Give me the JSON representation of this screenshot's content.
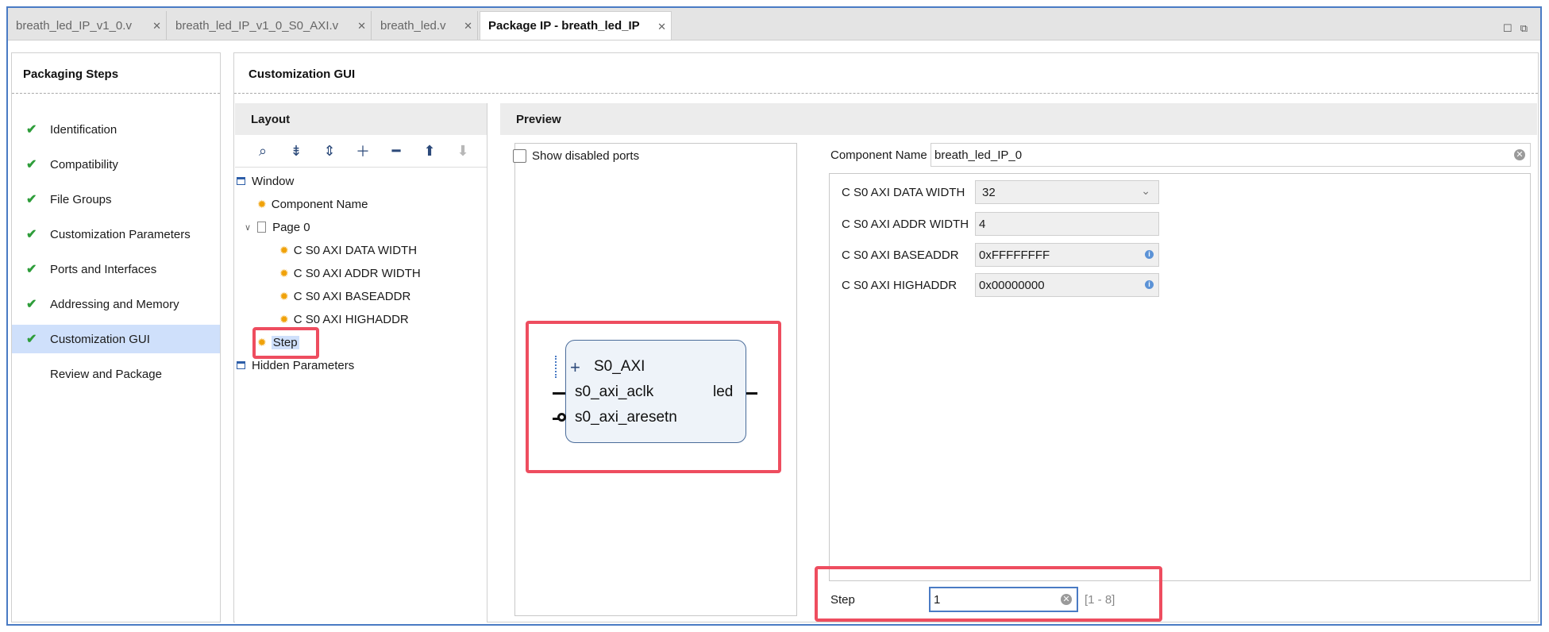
{
  "tabs": [
    {
      "label": "breath_led_IP_v1_0.v"
    },
    {
      "label": "breath_led_IP_v1_0_S0_AXI.v"
    },
    {
      "label": "breath_led.v"
    },
    {
      "label": "Package IP - breath_led_IP"
    }
  ],
  "packaging_steps": {
    "title": "Packaging Steps",
    "items": [
      {
        "label": "Identification",
        "done": true
      },
      {
        "label": "Compatibility",
        "done": true
      },
      {
        "label": "File Groups",
        "done": true
      },
      {
        "label": "Customization Parameters",
        "done": true
      },
      {
        "label": "Ports and Interfaces",
        "done": true
      },
      {
        "label": "Addressing and Memory",
        "done": true
      },
      {
        "label": "Customization GUI",
        "done": true,
        "selected": true
      },
      {
        "label": "Review and Package",
        "done": false
      }
    ]
  },
  "customization_gui": {
    "title": "Customization GUI",
    "layout": {
      "title": "Layout",
      "tree": {
        "window": "Window",
        "component_name": "Component Name",
        "page0": "Page 0",
        "params": [
          "C S0 AXI DATA WIDTH",
          "C S0 AXI ADDR WIDTH",
          "C S0 AXI BASEADDR",
          "C S0 AXI HIGHADDR"
        ],
        "step": "Step",
        "hidden": "Hidden Parameters"
      }
    },
    "preview": {
      "title": "Preview",
      "show_disabled_ports": "Show disabled ports",
      "ip_block": {
        "interface": "S0_AXI",
        "ports_left": [
          "s0_axi_aclk",
          "s0_axi_aresetn"
        ],
        "ports_right": [
          "led"
        ]
      },
      "component_name_label": "Component Name",
      "component_name_value": "breath_led_IP_0",
      "params": [
        {
          "label": "C S0 AXI DATA WIDTH",
          "value": "32"
        },
        {
          "label": "C S0 AXI ADDR WIDTH",
          "value": "4"
        },
        {
          "label": "C S0 AXI BASEADDR",
          "value": "0xFFFFFFFF"
        },
        {
          "label": "C S0 AXI HIGHADDR",
          "value": "0x00000000"
        }
      ],
      "step_label": "Step",
      "step_value": "1",
      "step_range": "[1 - 8]"
    }
  },
  "colors": {
    "accent_check": "#2e9d3a",
    "selection": "#cfe0fb",
    "highlight_box": "#ee4d5f",
    "frame": "#4a7bc4"
  }
}
